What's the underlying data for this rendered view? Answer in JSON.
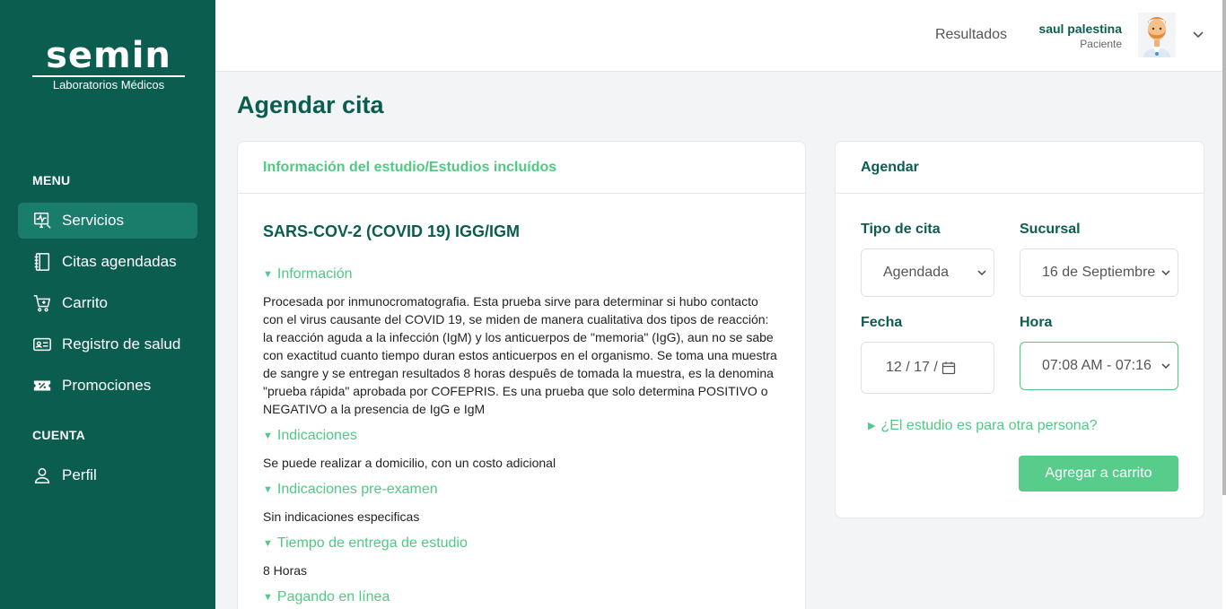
{
  "brand": {
    "name": "semin",
    "subtitle": "Laboratorios Médicos"
  },
  "sidebar": {
    "menu_label": "MENU",
    "account_label": "CUENTA",
    "items": [
      {
        "label": "Servicios",
        "icon": "monitor-pulse-icon",
        "active": true
      },
      {
        "label": "Citas agendadas",
        "icon": "notebook-icon"
      },
      {
        "label": "Carrito",
        "icon": "cart-icon"
      },
      {
        "label": "Registro de salud",
        "icon": "id-card-icon"
      },
      {
        "label": "Promociones",
        "icon": "ticket-percent-icon"
      }
    ],
    "account_items": [
      {
        "label": "Perfil",
        "icon": "user-icon"
      }
    ]
  },
  "header": {
    "results_link": "Resultados",
    "user_name": "saul palestina",
    "user_role": "Paciente"
  },
  "page": {
    "title": "Agendar cita"
  },
  "study_card": {
    "header": "Información del estudio/Estudios incluídos",
    "study_name": "SARS-COV-2 (COVID 19) IGG/IGM",
    "sections": [
      {
        "title": "Información",
        "text": "Procesada por inmunocromatografia. Esta prueba sirve para determinar si hubo contacto con el virus causante del COVID 19, se miden de manera cualitativa dos tipos de reacción: la reacción aguda a la infección (IgM) y los anticuerpos de \"memoria\" (IgG), aun no se sabe con exactitud cuanto tiempo duran estos anticuerpos en el organismo. Se toma una muestra de sangre y se entregan resultados 8 horas despuês de tomada la muestra, es la denomina \"prueba rápida\" aprobada por COFEPRIS. Es una prueba que solo determina POSITIVO o NEGATIVO a la presencia de IgG e IgM"
      },
      {
        "title": "Indicaciones",
        "text": "Se puede realizar a domicilio, con un costo adicional"
      },
      {
        "title": "Indicaciones pre-examen",
        "text": "Sin indicaciones especificas"
      },
      {
        "title": "Tiempo de entrega de estudio",
        "text": "8 Horas"
      },
      {
        "title": "Pagando en línea",
        "text": ""
      }
    ]
  },
  "schedule_card": {
    "header": "Agendar",
    "tipo_label": "Tipo de cita",
    "tipo_value": "Agendada",
    "sucursal_label": "Sucursal",
    "sucursal_value": "16 de Septiembre",
    "fecha_label": "Fecha",
    "fecha_value": "12 / 17 /",
    "hora_label": "Hora",
    "hora_value": "07:08 AM - 07:16",
    "other_person": "¿El estudio es para otra persona?",
    "add_to_cart": "Agregar a carrito"
  },
  "colors": {
    "sidebar": "#0b5d50",
    "accent": "#50c985",
    "active_item": "#1a7d6c"
  }
}
